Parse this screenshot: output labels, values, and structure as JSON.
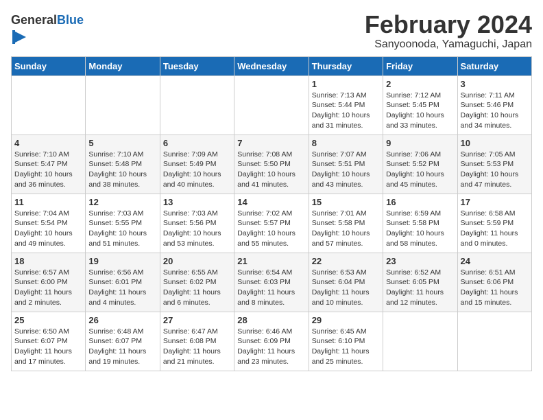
{
  "header": {
    "logo_general": "General",
    "logo_blue": "Blue",
    "month_title": "February 2024",
    "location": "Sanyoonoda, Yamaguchi, Japan"
  },
  "weekdays": [
    "Sunday",
    "Monday",
    "Tuesday",
    "Wednesday",
    "Thursday",
    "Friday",
    "Saturday"
  ],
  "weeks": [
    [
      {
        "day": "",
        "info": ""
      },
      {
        "day": "",
        "info": ""
      },
      {
        "day": "",
        "info": ""
      },
      {
        "day": "",
        "info": ""
      },
      {
        "day": "1",
        "info": "Sunrise: 7:13 AM\nSunset: 5:44 PM\nDaylight: 10 hours\nand 31 minutes."
      },
      {
        "day": "2",
        "info": "Sunrise: 7:12 AM\nSunset: 5:45 PM\nDaylight: 10 hours\nand 33 minutes."
      },
      {
        "day": "3",
        "info": "Sunrise: 7:11 AM\nSunset: 5:46 PM\nDaylight: 10 hours\nand 34 minutes."
      }
    ],
    [
      {
        "day": "4",
        "info": "Sunrise: 7:10 AM\nSunset: 5:47 PM\nDaylight: 10 hours\nand 36 minutes."
      },
      {
        "day": "5",
        "info": "Sunrise: 7:10 AM\nSunset: 5:48 PM\nDaylight: 10 hours\nand 38 minutes."
      },
      {
        "day": "6",
        "info": "Sunrise: 7:09 AM\nSunset: 5:49 PM\nDaylight: 10 hours\nand 40 minutes."
      },
      {
        "day": "7",
        "info": "Sunrise: 7:08 AM\nSunset: 5:50 PM\nDaylight: 10 hours\nand 41 minutes."
      },
      {
        "day": "8",
        "info": "Sunrise: 7:07 AM\nSunset: 5:51 PM\nDaylight: 10 hours\nand 43 minutes."
      },
      {
        "day": "9",
        "info": "Sunrise: 7:06 AM\nSunset: 5:52 PM\nDaylight: 10 hours\nand 45 minutes."
      },
      {
        "day": "10",
        "info": "Sunrise: 7:05 AM\nSunset: 5:53 PM\nDaylight: 10 hours\nand 47 minutes."
      }
    ],
    [
      {
        "day": "11",
        "info": "Sunrise: 7:04 AM\nSunset: 5:54 PM\nDaylight: 10 hours\nand 49 minutes."
      },
      {
        "day": "12",
        "info": "Sunrise: 7:03 AM\nSunset: 5:55 PM\nDaylight: 10 hours\nand 51 minutes."
      },
      {
        "day": "13",
        "info": "Sunrise: 7:03 AM\nSunset: 5:56 PM\nDaylight: 10 hours\nand 53 minutes."
      },
      {
        "day": "14",
        "info": "Sunrise: 7:02 AM\nSunset: 5:57 PM\nDaylight: 10 hours\nand 55 minutes."
      },
      {
        "day": "15",
        "info": "Sunrise: 7:01 AM\nSunset: 5:58 PM\nDaylight: 10 hours\nand 57 minutes."
      },
      {
        "day": "16",
        "info": "Sunrise: 6:59 AM\nSunset: 5:58 PM\nDaylight: 10 hours\nand 58 minutes."
      },
      {
        "day": "17",
        "info": "Sunrise: 6:58 AM\nSunset: 5:59 PM\nDaylight: 11 hours\nand 0 minutes."
      }
    ],
    [
      {
        "day": "18",
        "info": "Sunrise: 6:57 AM\nSunset: 6:00 PM\nDaylight: 11 hours\nand 2 minutes."
      },
      {
        "day": "19",
        "info": "Sunrise: 6:56 AM\nSunset: 6:01 PM\nDaylight: 11 hours\nand 4 minutes."
      },
      {
        "day": "20",
        "info": "Sunrise: 6:55 AM\nSunset: 6:02 PM\nDaylight: 11 hours\nand 6 minutes."
      },
      {
        "day": "21",
        "info": "Sunrise: 6:54 AM\nSunset: 6:03 PM\nDaylight: 11 hours\nand 8 minutes."
      },
      {
        "day": "22",
        "info": "Sunrise: 6:53 AM\nSunset: 6:04 PM\nDaylight: 11 hours\nand 10 minutes."
      },
      {
        "day": "23",
        "info": "Sunrise: 6:52 AM\nSunset: 6:05 PM\nDaylight: 11 hours\nand 12 minutes."
      },
      {
        "day": "24",
        "info": "Sunrise: 6:51 AM\nSunset: 6:06 PM\nDaylight: 11 hours\nand 15 minutes."
      }
    ],
    [
      {
        "day": "25",
        "info": "Sunrise: 6:50 AM\nSunset: 6:07 PM\nDaylight: 11 hours\nand 17 minutes."
      },
      {
        "day": "26",
        "info": "Sunrise: 6:48 AM\nSunset: 6:07 PM\nDaylight: 11 hours\nand 19 minutes."
      },
      {
        "day": "27",
        "info": "Sunrise: 6:47 AM\nSunset: 6:08 PM\nDaylight: 11 hours\nand 21 minutes."
      },
      {
        "day": "28",
        "info": "Sunrise: 6:46 AM\nSunset: 6:09 PM\nDaylight: 11 hours\nand 23 minutes."
      },
      {
        "day": "29",
        "info": "Sunrise: 6:45 AM\nSunset: 6:10 PM\nDaylight: 11 hours\nand 25 minutes."
      },
      {
        "day": "",
        "info": ""
      },
      {
        "day": "",
        "info": ""
      }
    ]
  ]
}
